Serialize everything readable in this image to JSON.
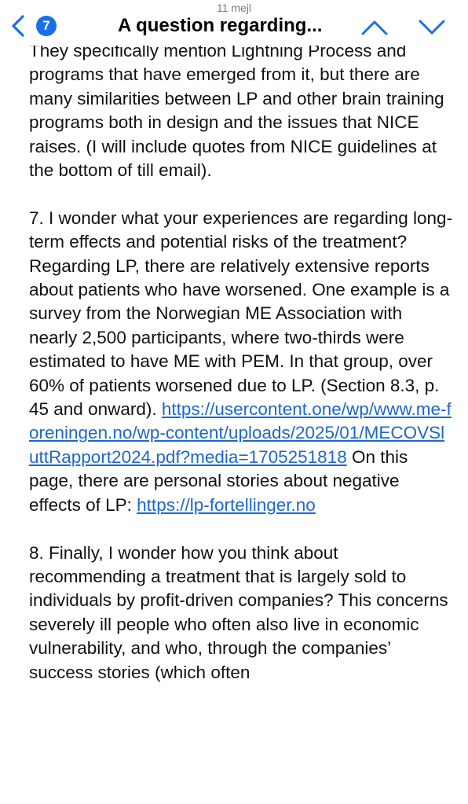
{
  "nav": {
    "message_count_label": "11 mejl",
    "back_badge": "7",
    "subject": "A question regarding..."
  },
  "body": {
    "para1_cut": "They specifically mention Lightning Process",
    "para1_rest": "and programs that have emerged from it, but there are many similarities between LP and other brain training programs both in design and the issues that NICE raises. (I will include quotes from NICE guidelines at the bottom of till email).",
    "para2_text": "7. I wonder what your experiences are regarding long-term effects and potential risks of the treatment? Regarding LP, there are relatively extensive reports about patients who have worsened. One example is a survey from the Norwegian ME Association with nearly 2,500 participants, where two-thirds were estimated to have ME with PEM. In that group, over 60% of patients worsened due to LP. (Section 8.3, p. 45 and onward). ",
    "link1": "https://usercontent.one/wp/www.me-foreningen.no/wp-content/uploads/2025/01/MECOVSluttRapport2024.pdf?media=1705251818",
    "para2_mid": " On this page, there are personal stories about negative effects of LP: ",
    "link2": "https://lp-fortellinger.no",
    "para3_text": "8. Finally, I wonder how you think about recommending a treatment that is largely sold to individuals by profit-driven companies? This concerns severely ill people who often also live in economic vulnerability, and who, through the companies’ success stories (which often"
  },
  "colors": {
    "accent": "#1a6ee8",
    "link": "#1d68c8"
  },
  "icons": [
    "chevron-left-icon",
    "chevron-up-icon",
    "chevron-down-icon"
  ]
}
